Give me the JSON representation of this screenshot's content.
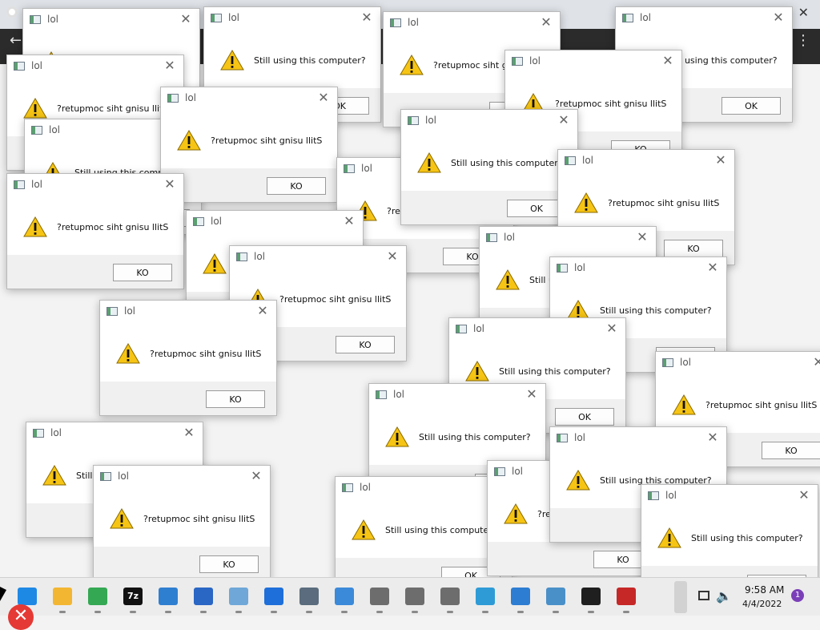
{
  "dialog": {
    "title": "lol",
    "message_normal": "Still using this computer?",
    "message_reversed": "?retupmoc siht gnisu llitS",
    "button_normal": "OK",
    "button_reversed": "KO",
    "close_glyph": "✕"
  },
  "dialogs": [
    {
      "variant": "reversed"
    },
    {
      "variant": "normal"
    },
    {
      "variant": "reversed"
    },
    {
      "variant": "normal"
    },
    {
      "variant": "reversed"
    },
    {
      "variant": "reversed"
    },
    {
      "variant": "normal"
    },
    {
      "variant": "reversed"
    },
    {
      "variant": "reversed"
    },
    {
      "variant": "normal"
    },
    {
      "variant": "reversed"
    },
    {
      "variant": "reversed"
    },
    {
      "variant": "reversed"
    },
    {
      "variant": "normal"
    },
    {
      "variant": "reversed"
    },
    {
      "variant": "normal"
    },
    {
      "variant": "normal"
    },
    {
      "variant": "reversed"
    },
    {
      "variant": "normal"
    },
    {
      "variant": "reversed"
    },
    {
      "variant": "normal"
    },
    {
      "variant": "reversed"
    },
    {
      "variant": "normal"
    },
    {
      "variant": "reversed"
    },
    {
      "variant": "normal"
    },
    {
      "variant": "normal"
    }
  ],
  "taskbar": {
    "time": "9:58 AM",
    "date": "4/4/2022",
    "notification_count": "1",
    "apps": [
      {
        "icon": "windows-start-icon",
        "color": "#1e88e5"
      },
      {
        "icon": "file-explorer-icon",
        "color": "#f2b632"
      },
      {
        "icon": "chrome-icon",
        "color": "#34a853"
      },
      {
        "icon": "7zip-icon",
        "color": "#111111",
        "label": "7z"
      },
      {
        "icon": "notepad-icon",
        "color": "#2f7fd1"
      },
      {
        "icon": "image-viewer-icon",
        "color": "#2a66c4"
      },
      {
        "icon": "paint-icon",
        "color": "#6fa7d8"
      },
      {
        "icon": "active-app-icon",
        "color": "#1e6fd9"
      },
      {
        "icon": "calculator-icon",
        "color": "#5a6c7d"
      },
      {
        "icon": "control-panel-icon",
        "color": "#3b8ad9"
      },
      {
        "icon": "network-computer-icon",
        "color": "#6d6d6d"
      },
      {
        "icon": "network-computer-icon",
        "color": "#6d6d6d"
      },
      {
        "icon": "network-computer-icon",
        "color": "#6d6d6d"
      },
      {
        "icon": "globe-icon",
        "color": "#2e9bd6"
      },
      {
        "icon": "puzzle-icon",
        "color": "#2d7dd2"
      },
      {
        "icon": "performance-monitor-icon",
        "color": "#4a90c8"
      },
      {
        "icon": "terminal-icon",
        "color": "#1f1f1f"
      },
      {
        "icon": "toolbox-icon",
        "color": "#c62828"
      }
    ]
  }
}
